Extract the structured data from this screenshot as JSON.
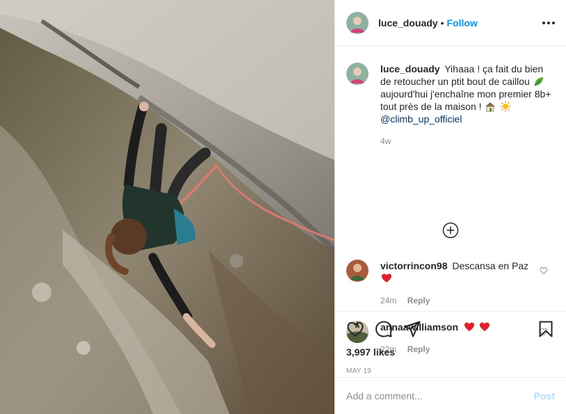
{
  "header": {
    "username": "luce_douady",
    "dot": "•",
    "follow_label": "Follow",
    "more_icon": "more-options-icon"
  },
  "caption": {
    "username": "luce_douady",
    "line1": "Yihaaa ! ça fait du bien de retoucher un ptit bout de caillou",
    "line2": "aujourd'hui j'enchaîne mon premier 8b+ tout près de la maison !",
    "mention": "@climb_up_officiel",
    "time": "4w",
    "emojis": [
      "leaf",
      "house",
      "sun"
    ]
  },
  "load_more_icon": "plus-circle-icon",
  "comments": [
    {
      "username": "victorrincon98",
      "text": "Descansa en Paz",
      "emojis": [
        "red-heart"
      ],
      "time": "24m",
      "reply_label": "Reply"
    },
    {
      "username": "annaawilliamson",
      "text": "",
      "emojis": [
        "red-heart",
        "red-heart"
      ],
      "time": "22m",
      "reply_label": "Reply"
    }
  ],
  "actions": {
    "likes": "3,997 likes",
    "date": "MAY 19"
  },
  "add_comment": {
    "placeholder": "Add a comment...",
    "post_label": "Post"
  },
  "colors": {
    "accent": "#0095f6",
    "post_disabled": "#b2dffc",
    "muted": "#8e8e8e",
    "heart": "#ed4956"
  }
}
